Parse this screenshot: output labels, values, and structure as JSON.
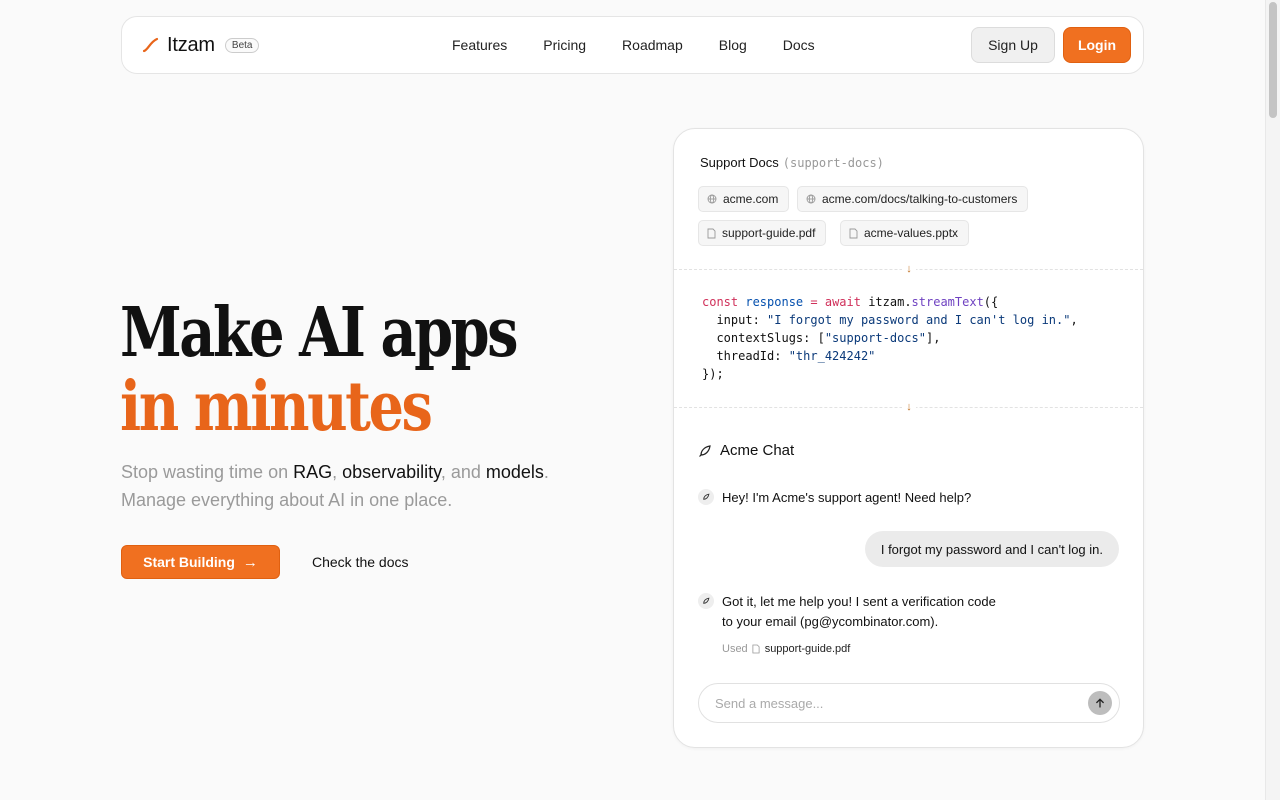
{
  "nav": {
    "brand": "Itzam",
    "badge": "Beta",
    "links": [
      "Features",
      "Pricing",
      "Roadmap",
      "Blog",
      "Docs"
    ],
    "signup_label": "Sign Up",
    "login_label": "Login"
  },
  "hero": {
    "title_line1": "Make AI apps",
    "title_line2": "in minutes",
    "sub_part1": "Stop wasting time on ",
    "sub_rag": "RAG",
    "sub_comma1": ", ",
    "sub_obs": "observability",
    "sub_and": ", and ",
    "sub_models": "models",
    "sub_period": ".",
    "sub_line2": "Manage everything about AI in one place.",
    "start_label": "Start Building",
    "docs_label": "Check the docs"
  },
  "card": {
    "context_name": "Support Docs",
    "context_slug": "(support-docs)",
    "sources": [
      {
        "label": "acme.com",
        "icon": "globe-icon"
      },
      {
        "label": "acme.com/docs/talking-to-customers",
        "icon": "globe-icon"
      },
      {
        "label": "support-guide.pdf",
        "icon": "file-icon"
      },
      {
        "label": "acme-values.pptx",
        "icon": "file-icon"
      }
    ],
    "code": {
      "l1_const": "const",
      "l1_var": "response",
      "l1_eq": " = ",
      "l1_await": "await",
      "l1_obj": " itzam.",
      "l1_fn": "streamText",
      "l1_open": "({",
      "l2_key": "  input: ",
      "l2_val": "\"I forgot my password and I can't log in.\"",
      "l2_end": ",",
      "l3_key": "  contextSlugs: [",
      "l3_val": "\"support-docs\"",
      "l3_end": "],",
      "l4_key": "  threadId: ",
      "l4_val": "\"thr_424242\"",
      "l5": "});"
    },
    "chat": {
      "title": "Acme Chat",
      "bot_msg1": "Hey! I'm Acme's support agent! Need help?",
      "user_msg": "I forgot my password and I can't log in.",
      "bot_msg2_line1": "Got it, let me help you! I sent a verification code",
      "bot_msg2_line2": "to your email (pg@ycombinator.com).",
      "used_label": "Used",
      "used_file": "support-guide.pdf",
      "input_placeholder": "Send a message..."
    }
  },
  "colors": {
    "accent": "#f07020",
    "title_accent": "#e8651a"
  }
}
